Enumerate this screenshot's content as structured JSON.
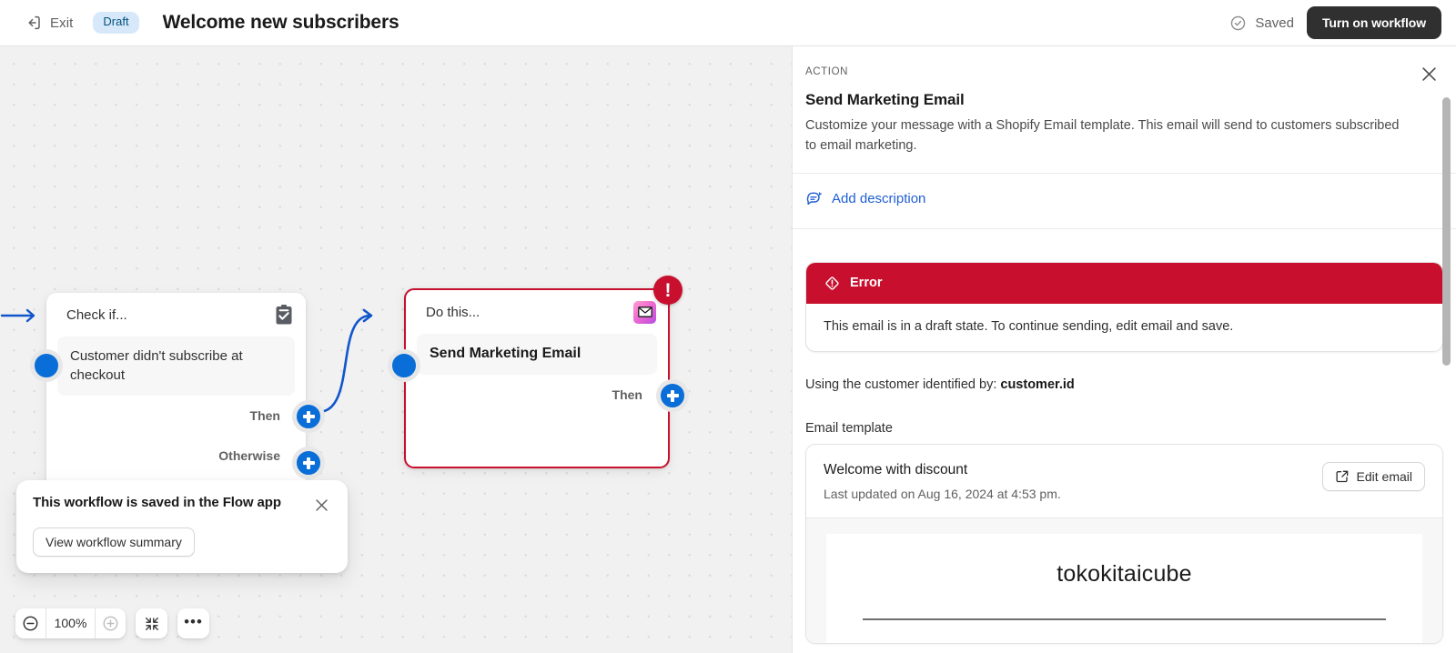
{
  "topbar": {
    "exit_label": "Exit",
    "exit_icon": "exit-arrow-icon",
    "status_badge": "Draft",
    "workflow_title": "Welcome new subscribers",
    "saved_label": "Saved",
    "saved_icon": "check-circle-icon",
    "primary_button": "Turn on workflow"
  },
  "canvas": {
    "nodes": [
      {
        "title": "Check if...",
        "icon": "clipboard-check-icon",
        "body": "Customer didn't subscribe at checkout",
        "branches": [
          "Then",
          "Otherwise"
        ]
      },
      {
        "title": "Do this...",
        "icon": "email-envelope-icon",
        "body": "Send Marketing Email",
        "branches": [
          "Then"
        ],
        "error_badge": "!"
      }
    ],
    "toast": {
      "title": "This workflow is saved in the Flow app",
      "button": "View workflow summary",
      "close_icon": "close-icon"
    },
    "zoom_controls": {
      "zoom_out_icon": "minus-circle-icon",
      "zoom_level": "100%",
      "zoom_in_icon": "plus-circle-icon",
      "fit_icon": "collapse-arrows-icon",
      "more_icon": "ellipsis-icon"
    }
  },
  "panel": {
    "eyebrow": "ACTION",
    "close_icon": "close-icon",
    "title": "Send Marketing Email",
    "description": "Customize your message with a Shopify Email template. This email will send to customers subscribed to email marketing.",
    "add_description": {
      "icon": "comment-icon",
      "label": "Add description"
    },
    "error": {
      "icon": "alert-diamond-icon",
      "heading": "Error",
      "message": "This email is in a draft state. To continue sending, edit email and save.",
      "color": "#c8102e"
    },
    "using_customer_prefix": "Using the customer identified by: ",
    "using_customer_value": "customer.id",
    "email_template_label": "Email template",
    "template": {
      "name": "Welcome with discount",
      "updated": "Last updated on Aug 16, 2024 at 4:53 pm.",
      "edit_button": "Edit email",
      "edit_icon": "external-link-icon",
      "preview_brand": "tokokitaicube"
    }
  },
  "colors": {
    "accent_blue": "#0a6ed8",
    "link_blue": "#1f5fd4",
    "error_red": "#c8102e",
    "dark_button": "#303030",
    "badge_blue_bg": "#d7e8fb"
  }
}
